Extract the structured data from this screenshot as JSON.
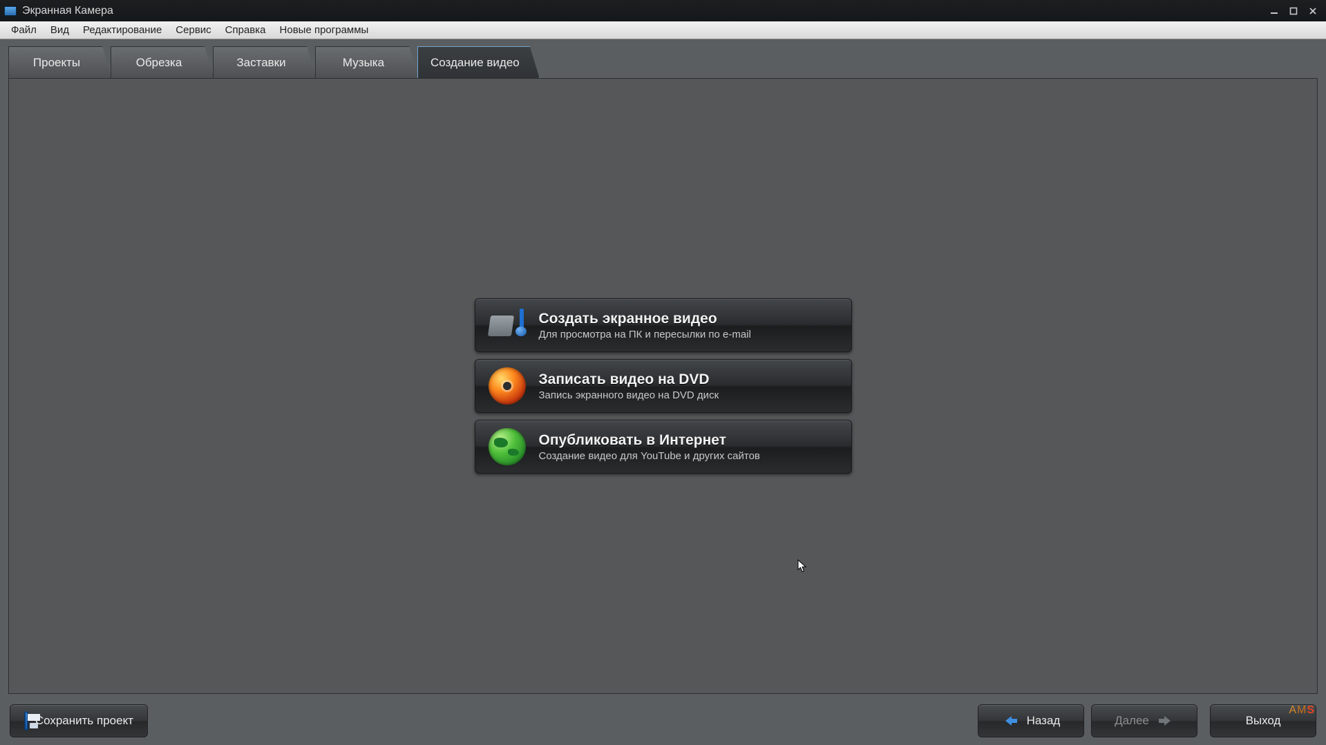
{
  "window": {
    "title": "Экранная Камера"
  },
  "menubar": {
    "items": [
      "Файл",
      "Вид",
      "Редактирование",
      "Сервис",
      "Справка",
      "Новые программы"
    ]
  },
  "tabs": {
    "items": [
      "Проекты",
      "Обрезка",
      "Заставки",
      "Музыка",
      "Создание видео"
    ],
    "active_index": 4
  },
  "options": [
    {
      "icon": "film-note-icon",
      "title": "Создать экранное видео",
      "subtitle": "Для просмотра на ПК и пересылки по e-mail"
    },
    {
      "icon": "dvd-icon",
      "title": "Записать видео на DVD",
      "subtitle": "Запись экранного видео на DVD диск"
    },
    {
      "icon": "globe-icon",
      "title": "Опубликовать в Интернет",
      "subtitle": "Создание видео для YouTube и других сайтов"
    }
  ],
  "bottom": {
    "save_label": "Сохранить проект",
    "back_label": "Назад",
    "next_label": "Далее",
    "exit_label": "Выход",
    "next_enabled": false
  },
  "branding": {
    "text": "AMS"
  }
}
